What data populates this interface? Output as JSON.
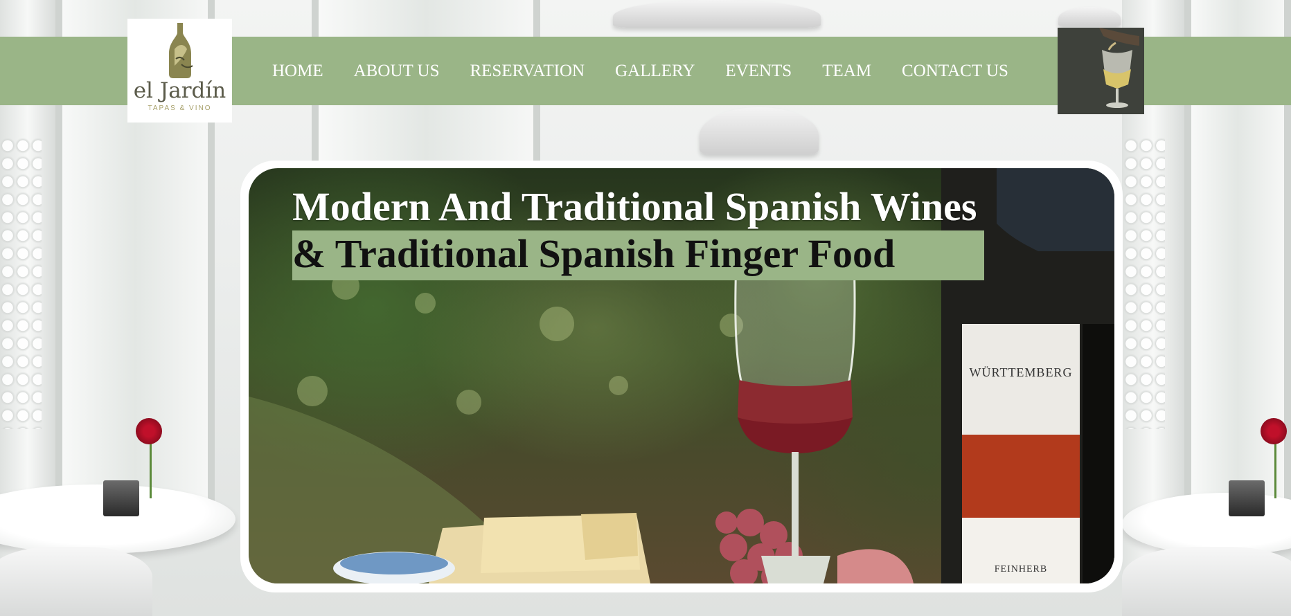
{
  "brand": {
    "name": "el Jardín",
    "tagline": "TAPAS & VINO"
  },
  "nav": {
    "items": [
      {
        "label": "HOME"
      },
      {
        "label": "ABOUT US"
      },
      {
        "label": "RESERVATION"
      },
      {
        "label": "GALLERY"
      },
      {
        "label": "EVENTS"
      },
      {
        "label": "TEAM"
      },
      {
        "label": "CONTACT US"
      }
    ]
  },
  "hero": {
    "title_line1": "Modern And Traditional Spanish Wines",
    "title_line2": "& Traditional Spanish Finger Food",
    "bottle_label": "WÜRTTEMBERG",
    "bottle_label_bottom": "FEINHERB"
  },
  "colors": {
    "nav_bar": "#9ab587",
    "nav_text": "#ffffff",
    "hero_highlight": "#9ab587"
  },
  "icons": {
    "logo": "wine-bottle-icon",
    "nav_image": "wine-pour-icon"
  }
}
